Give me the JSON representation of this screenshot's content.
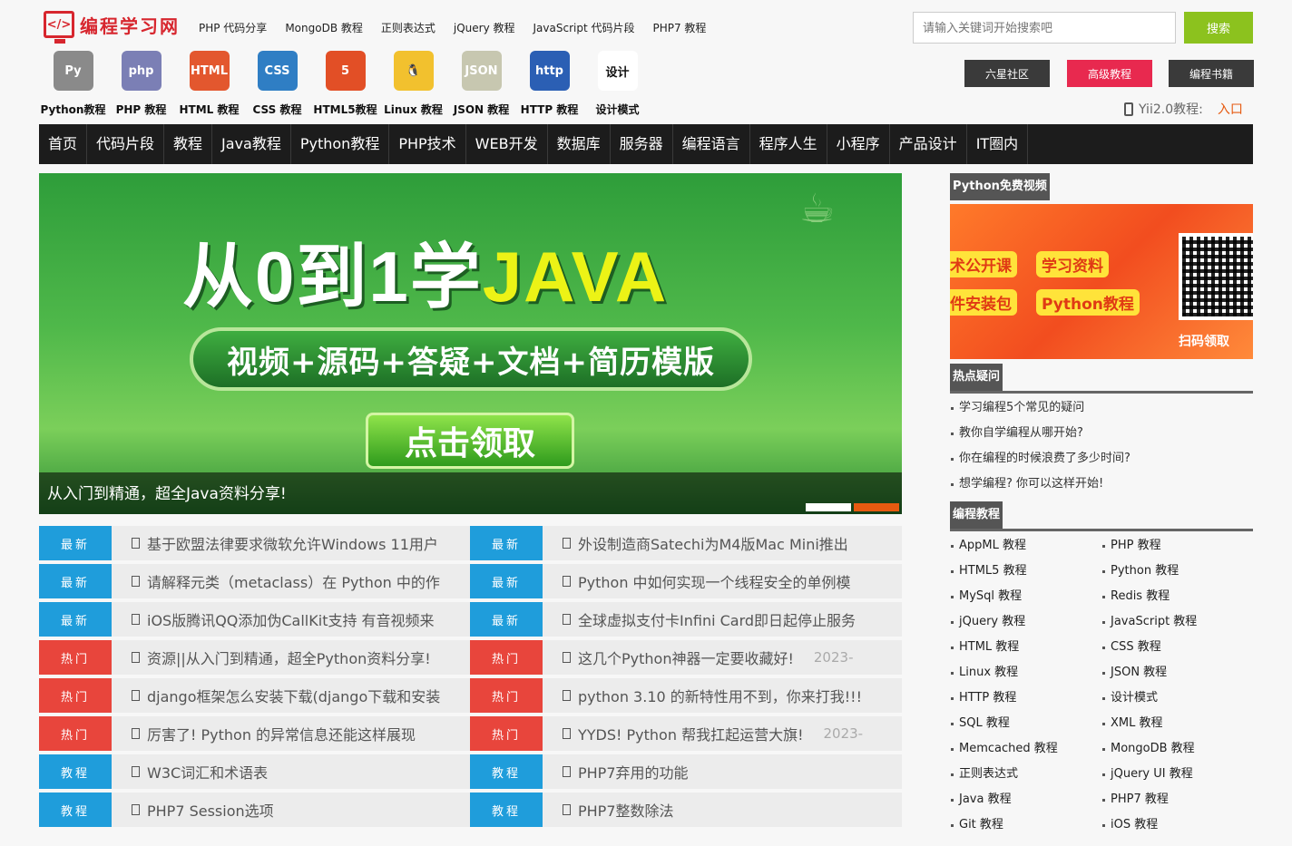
{
  "site": {
    "logo_text": "编程学习网",
    "logo_glyph": "</>"
  },
  "topnav": [
    "PHP 代码分享",
    "MongoDB 教程",
    "正则表达式",
    "jQuery 教程",
    "JavaScript 代码片段",
    "PHP7 教程"
  ],
  "search": {
    "placeholder": "请输入关键词开始搜索吧",
    "button": "搜索"
  },
  "icons": [
    {
      "label": "Python教程",
      "glyph": "Py",
      "color": "#8a8a8a",
      "icon": "python-icon"
    },
    {
      "label": "PHP 教程",
      "glyph": "php",
      "color": "#7b7fb5",
      "icon": "php-icon"
    },
    {
      "label": "HTML 教程",
      "glyph": "HTML",
      "color": "#e3572e",
      "icon": "html-icon"
    },
    {
      "label": "CSS 教程",
      "glyph": "CSS",
      "color": "#2f7ec4",
      "icon": "css-icon"
    },
    {
      "label": "HTML5教程",
      "glyph": "5",
      "color": "#e24f26",
      "icon": "html5-icon"
    },
    {
      "label": "Linux 教程",
      "glyph": "🐧",
      "color": "#f2c12e",
      "icon": "linux-icon"
    },
    {
      "label": "JSON 教程",
      "glyph": "JSON",
      "color": "#c7c7b0",
      "icon": "json-icon"
    },
    {
      "label": "HTTP 教程",
      "glyph": "http",
      "color": "#2b5fb4",
      "icon": "http-icon"
    },
    {
      "label": "设计模式",
      "glyph": "设计",
      "color": "#ffffff",
      "icon": "design-pattern-icon"
    }
  ],
  "right_buttons": [
    {
      "label": "六星社区",
      "color": "#3a3a3a"
    },
    {
      "label": "高级教程",
      "color": "#e8294f"
    },
    {
      "label": "编程书籍",
      "color": "#3a3a3a"
    }
  ],
  "yii": {
    "label": "Yii2.0教程:",
    "link": "入口"
  },
  "mainnav": [
    "首页",
    "代码片段",
    "教程",
    "Java教程",
    "Python教程",
    "PHP技术",
    "WEB开发",
    "数据库",
    "服务器",
    "编程语言",
    "程序人生",
    "小程序",
    "产品设计",
    "IT圈内"
  ],
  "banner": {
    "headline_a": "从0到1学",
    "headline_b": "JAVA",
    "pill": "视频+源码+答疑+文档+简历模版",
    "cta": "点击领取",
    "caption": "从入门到精通，超全Java资料分享!"
  },
  "news_left": [
    {
      "tag": "最新",
      "kind": "new",
      "text": "基于欧盟法律要求微软允许Windows 11用户",
      "date": ""
    },
    {
      "tag": "最新",
      "kind": "new",
      "text": "请解释元类（metaclass）在 Python 中的作",
      "date": ""
    },
    {
      "tag": "最新",
      "kind": "new",
      "text": "iOS版腾讯QQ添加伪CallKit支持 有音视频来",
      "date": ""
    },
    {
      "tag": "热门",
      "kind": "hot",
      "text": "资源||从入门到精通，超全Python资料分享!",
      "date": ""
    },
    {
      "tag": "热门",
      "kind": "hot",
      "text": "django框架怎么安装下载(django下载和安装",
      "date": ""
    },
    {
      "tag": "热门",
      "kind": "hot",
      "text": "厉害了! Python 的异常信息还能这样展现",
      "date": ""
    },
    {
      "tag": "教程",
      "kind": "tut",
      "text": "W3C词汇和术语表",
      "date": ""
    },
    {
      "tag": "教程",
      "kind": "tut",
      "text": "PHP7 Session选项",
      "date": ""
    }
  ],
  "news_right": [
    {
      "tag": "最新",
      "kind": "new",
      "text": "外设制造商Satechi为M4版Mac Mini推出",
      "date": ""
    },
    {
      "tag": "最新",
      "kind": "new",
      "text": "Python 中如何实现一个线程安全的单例模",
      "date": ""
    },
    {
      "tag": "最新",
      "kind": "new",
      "text": "全球虚拟支付卡Infini Card即日起停止服务",
      "date": ""
    },
    {
      "tag": "热门",
      "kind": "hot",
      "text": "这几个Python神器一定要收藏好!",
      "date": "2023-"
    },
    {
      "tag": "热门",
      "kind": "hot",
      "text": "python 3.10 的新特性用不到，你来打我!!!",
      "date": ""
    },
    {
      "tag": "热门",
      "kind": "hot",
      "text": "YYDS! Python 帮我扛起运营大旗!",
      "date": "2023-"
    },
    {
      "tag": "教程",
      "kind": "tut",
      "text": "PHP7弃用的功能",
      "date": ""
    },
    {
      "tag": "教程",
      "kind": "tut",
      "text": "PHP7整数除法",
      "date": ""
    }
  ],
  "sidebar": {
    "video_title": "Python免费视频",
    "promo_tags": [
      "术公开课",
      "学习资料",
      "件安装包",
      "Python教程"
    ],
    "promo_scan": "扫码领取",
    "faq_title": "热点疑问",
    "faq": [
      "学习编程5个常见的疑问",
      "教你自学编程从哪开始?",
      "你在编程的时候浪费了多少时间?",
      "想学编程? 你可以这样开始!"
    ],
    "tutorials_title": "编程教程",
    "tutorials": [
      "AppML 教程",
      "PHP 教程",
      "HTML5 教程",
      "Python 教程",
      "MySql 教程",
      "Redis 教程",
      "jQuery 教程",
      "JavaScript 教程",
      "HTML 教程",
      "CSS 教程",
      "Linux 教程",
      "JSON 教程",
      "HTTP 教程",
      "设计模式",
      "SQL 教程",
      "XML 教程",
      "Memcached 教程",
      "MongoDB 教程",
      "正则表达式",
      "jQuery UI 教程",
      "Java 教程",
      "PHP7 教程",
      "Git 教程",
      "iOS 教程"
    ]
  }
}
